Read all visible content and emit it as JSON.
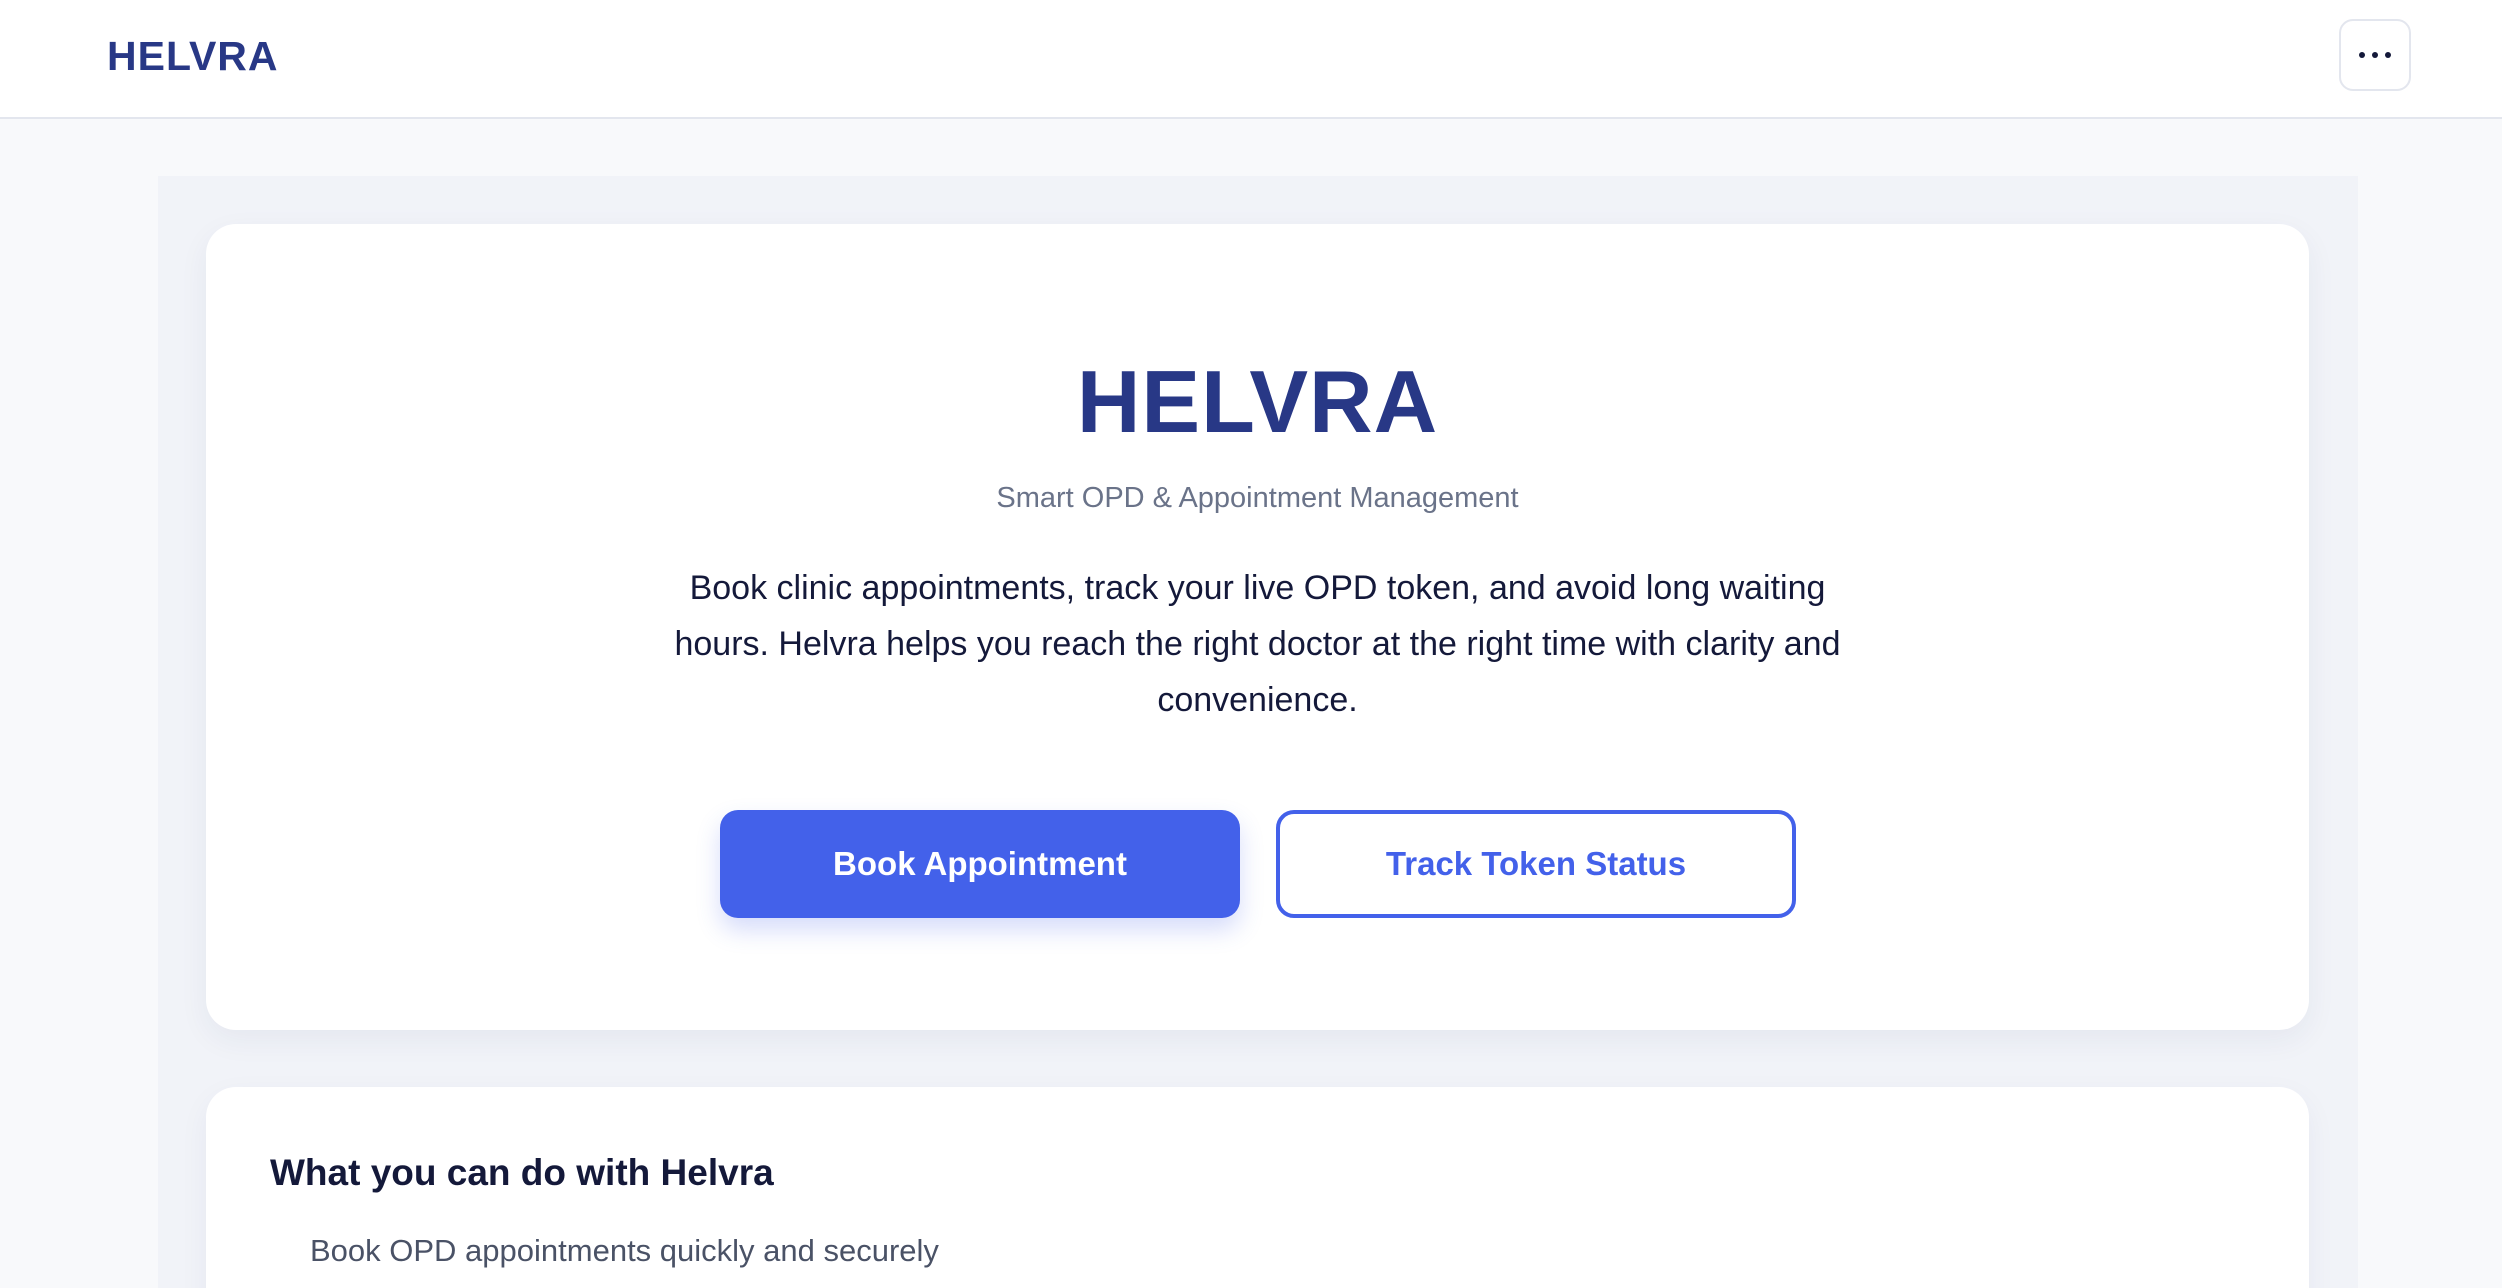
{
  "header": {
    "brand": "HELVRA",
    "menu_icon": "more-horizontal-icon"
  },
  "hero": {
    "title": "HELVRA",
    "subtitle": "Smart OPD & Appointment Management",
    "description": "Book clinic appointments, track your live OPD token, and avoid long waiting hours. Helvra helps you reach the right doctor at the right time with clarity and convenience.",
    "primary_button": "Book Appointment",
    "secondary_button": "Track Token Status"
  },
  "features": {
    "title": "What you can do with Helvra",
    "items": [
      "Book OPD appointments quickly and securely"
    ]
  },
  "colors": {
    "brand": "#283886",
    "accent": "#4361ea",
    "page_background": "#f8f9fb",
    "panel_background": "#f1f3f8"
  }
}
